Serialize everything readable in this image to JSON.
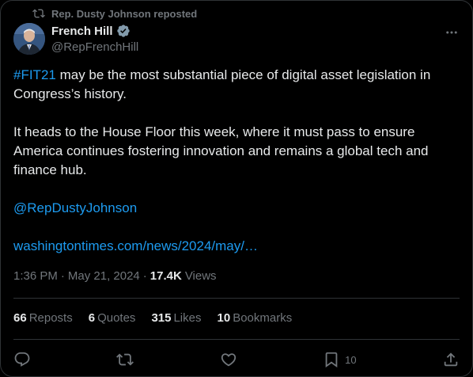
{
  "repost_banner": {
    "text": "Rep. Dusty Johnson reposted",
    "icon": "repost-icon"
  },
  "author": {
    "name": "French Hill",
    "handle": "@RepFrenchHill",
    "verified": true
  },
  "tweet": {
    "hashtag": "#FIT21",
    "line1_rest": " may be the most substantial piece of digital asset legislation in Congress’s history.",
    "paragraph2": "It heads to the House Floor this week, where it must pass to ensure America continues fostering innovation and remains a global tech and finance hub.",
    "mention": "@RepDustyJohnson",
    "url": "washingtontimes.com/news/2024/may/…"
  },
  "meta": {
    "time": "1:36 PM",
    "sep1": "·",
    "date": "May 21, 2024",
    "sep2": "·",
    "views_count": "17.4K",
    "views_label": "Views"
  },
  "stats": {
    "reposts_count": "66",
    "reposts_label": "Reposts",
    "quotes_count": "6",
    "quotes_label": "Quotes",
    "likes_count": "315",
    "likes_label": "Likes",
    "bookmarks_count": "10",
    "bookmarks_label": "Bookmarks"
  },
  "actions": {
    "bookmark_count": "10"
  },
  "colors": {
    "link": "#1d9bf0",
    "muted": "#71767b",
    "text": "#e7e9ea",
    "border": "#2f3336",
    "verified": "#829aab"
  }
}
